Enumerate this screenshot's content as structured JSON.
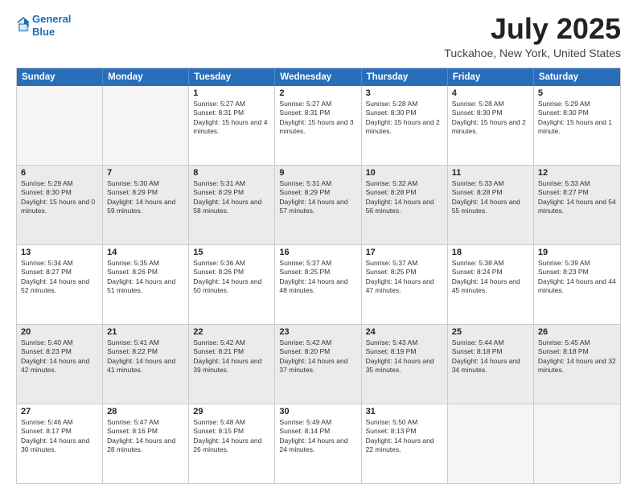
{
  "header": {
    "logo_line1": "General",
    "logo_line2": "Blue",
    "title": "July 2025",
    "subtitle": "Tuckahoe, New York, United States"
  },
  "days_of_week": [
    "Sunday",
    "Monday",
    "Tuesday",
    "Wednesday",
    "Thursday",
    "Friday",
    "Saturday"
  ],
  "weeks": [
    [
      {
        "day": "",
        "text": ""
      },
      {
        "day": "",
        "text": ""
      },
      {
        "day": "1",
        "text": "Sunrise: 5:27 AM\nSunset: 8:31 PM\nDaylight: 15 hours and 4 minutes."
      },
      {
        "day": "2",
        "text": "Sunrise: 5:27 AM\nSunset: 8:31 PM\nDaylight: 15 hours and 3 minutes."
      },
      {
        "day": "3",
        "text": "Sunrise: 5:28 AM\nSunset: 8:30 PM\nDaylight: 15 hours and 2 minutes."
      },
      {
        "day": "4",
        "text": "Sunrise: 5:28 AM\nSunset: 8:30 PM\nDaylight: 15 hours and 2 minutes."
      },
      {
        "day": "5",
        "text": "Sunrise: 5:29 AM\nSunset: 8:30 PM\nDaylight: 15 hours and 1 minute."
      }
    ],
    [
      {
        "day": "6",
        "text": "Sunrise: 5:29 AM\nSunset: 8:30 PM\nDaylight: 15 hours and 0 minutes."
      },
      {
        "day": "7",
        "text": "Sunrise: 5:30 AM\nSunset: 8:29 PM\nDaylight: 14 hours and 59 minutes."
      },
      {
        "day": "8",
        "text": "Sunrise: 5:31 AM\nSunset: 8:29 PM\nDaylight: 14 hours and 58 minutes."
      },
      {
        "day": "9",
        "text": "Sunrise: 5:31 AM\nSunset: 8:29 PM\nDaylight: 14 hours and 57 minutes."
      },
      {
        "day": "10",
        "text": "Sunrise: 5:32 AM\nSunset: 8:28 PM\nDaylight: 14 hours and 56 minutes."
      },
      {
        "day": "11",
        "text": "Sunrise: 5:33 AM\nSunset: 8:28 PM\nDaylight: 14 hours and 55 minutes."
      },
      {
        "day": "12",
        "text": "Sunrise: 5:33 AM\nSunset: 8:27 PM\nDaylight: 14 hours and 54 minutes."
      }
    ],
    [
      {
        "day": "13",
        "text": "Sunrise: 5:34 AM\nSunset: 8:27 PM\nDaylight: 14 hours and 52 minutes."
      },
      {
        "day": "14",
        "text": "Sunrise: 5:35 AM\nSunset: 8:26 PM\nDaylight: 14 hours and 51 minutes."
      },
      {
        "day": "15",
        "text": "Sunrise: 5:36 AM\nSunset: 8:26 PM\nDaylight: 14 hours and 50 minutes."
      },
      {
        "day": "16",
        "text": "Sunrise: 5:37 AM\nSunset: 8:25 PM\nDaylight: 14 hours and 48 minutes."
      },
      {
        "day": "17",
        "text": "Sunrise: 5:37 AM\nSunset: 8:25 PM\nDaylight: 14 hours and 47 minutes."
      },
      {
        "day": "18",
        "text": "Sunrise: 5:38 AM\nSunset: 8:24 PM\nDaylight: 14 hours and 45 minutes."
      },
      {
        "day": "19",
        "text": "Sunrise: 5:39 AM\nSunset: 8:23 PM\nDaylight: 14 hours and 44 minutes."
      }
    ],
    [
      {
        "day": "20",
        "text": "Sunrise: 5:40 AM\nSunset: 8:23 PM\nDaylight: 14 hours and 42 minutes."
      },
      {
        "day": "21",
        "text": "Sunrise: 5:41 AM\nSunset: 8:22 PM\nDaylight: 14 hours and 41 minutes."
      },
      {
        "day": "22",
        "text": "Sunrise: 5:42 AM\nSunset: 8:21 PM\nDaylight: 14 hours and 39 minutes."
      },
      {
        "day": "23",
        "text": "Sunrise: 5:42 AM\nSunset: 8:20 PM\nDaylight: 14 hours and 37 minutes."
      },
      {
        "day": "24",
        "text": "Sunrise: 5:43 AM\nSunset: 8:19 PM\nDaylight: 14 hours and 35 minutes."
      },
      {
        "day": "25",
        "text": "Sunrise: 5:44 AM\nSunset: 8:18 PM\nDaylight: 14 hours and 34 minutes."
      },
      {
        "day": "26",
        "text": "Sunrise: 5:45 AM\nSunset: 8:18 PM\nDaylight: 14 hours and 32 minutes."
      }
    ],
    [
      {
        "day": "27",
        "text": "Sunrise: 5:46 AM\nSunset: 8:17 PM\nDaylight: 14 hours and 30 minutes."
      },
      {
        "day": "28",
        "text": "Sunrise: 5:47 AM\nSunset: 8:16 PM\nDaylight: 14 hours and 28 minutes."
      },
      {
        "day": "29",
        "text": "Sunrise: 5:48 AM\nSunset: 8:15 PM\nDaylight: 14 hours and 26 minutes."
      },
      {
        "day": "30",
        "text": "Sunrise: 5:49 AM\nSunset: 8:14 PM\nDaylight: 14 hours and 24 minutes."
      },
      {
        "day": "31",
        "text": "Sunrise: 5:50 AM\nSunset: 8:13 PM\nDaylight: 14 hours and 22 minutes."
      },
      {
        "day": "",
        "text": ""
      },
      {
        "day": "",
        "text": ""
      }
    ]
  ]
}
